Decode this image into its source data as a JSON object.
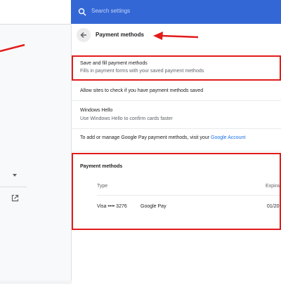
{
  "search": {
    "placeholder": "Search settings"
  },
  "header": {
    "title": "Payment methods"
  },
  "settings": {
    "save_fill": {
      "title": "Save and fill payment methods",
      "subtitle": "Fills in payment forms with your saved payment methods"
    },
    "allow_check": {
      "title": "Allow sites to check if you have payment methods saved"
    },
    "windows_hello": {
      "title": "Windows Hello",
      "subtitle": "Use Windows Hello to confirm cards faster"
    },
    "google_pay": {
      "text": "To add or manage Google Pay payment methods, visit your",
      "link": "Google Account"
    }
  },
  "payment_methods": {
    "heading": "Payment methods",
    "columns": {
      "type": "Type",
      "expiration": "Expira"
    },
    "rows": [
      {
        "card": "Visa •••• 3276",
        "source": "Google Pay",
        "expiration": "01/20"
      }
    ]
  },
  "colors": {
    "accent": "#3367d6",
    "annotation": "#e21b1b",
    "link": "#1a73e8"
  },
  "icons": {
    "search": "search-icon",
    "back": "back-arrow-icon",
    "sidebar_expand": "chevron-down-icon",
    "external": "open-in-new-icon"
  }
}
